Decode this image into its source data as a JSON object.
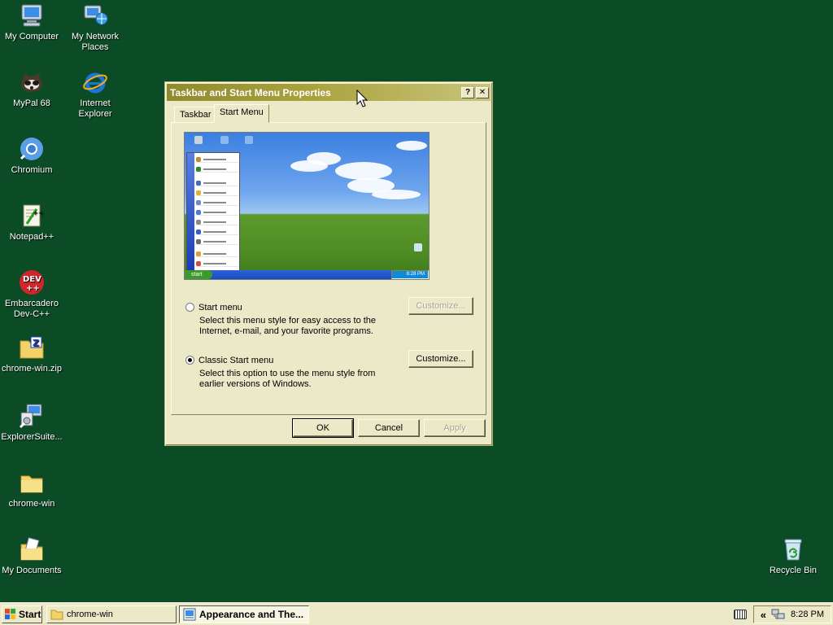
{
  "desktop_icons": [
    {
      "label": "My Computer",
      "icon": "computer-icon"
    },
    {
      "label": "My Network Places",
      "icon": "network-places-icon"
    },
    {
      "label": "MyPal 68",
      "icon": "mypal-icon"
    },
    {
      "label": "Internet Explorer",
      "icon": "internet-explorer-icon"
    },
    {
      "label": "Chromium",
      "icon": "chromium-icon"
    },
    {
      "label": "Notepad++",
      "icon": "notepad-plus-plus-icon"
    },
    {
      "label": "Embarcadero Dev-C++",
      "icon": "devcpp-icon"
    },
    {
      "label": "chrome-win.zip",
      "icon": "zip-folder-icon"
    },
    {
      "label": "ExplorerSuite...",
      "icon": "installer-icon"
    },
    {
      "label": "chrome-win",
      "icon": "folder-icon"
    },
    {
      "label": "My Documents",
      "icon": "my-documents-icon"
    },
    {
      "label": "Recycle Bin",
      "icon": "recycle-bin-icon"
    }
  ],
  "dialog": {
    "title": "Taskbar and Start Menu Properties",
    "help_button": "?",
    "close_button": "✕",
    "tabs": [
      {
        "label": "Taskbar",
        "selected": false
      },
      {
        "label": "Start Menu",
        "selected": true
      }
    ],
    "preview": {
      "start_label": "start",
      "clock": "8:28 PM"
    },
    "options": [
      {
        "label": "Start menu",
        "description": "Select this menu style for easy access to the Internet, e-mail, and your favorite programs.",
        "checked": false,
        "customize_label": "Customize...",
        "customize_enabled": false
      },
      {
        "label": "Classic Start menu",
        "description": "Select this option to use the menu style from earlier versions of Windows.",
        "checked": true,
        "customize_label": "Customize...",
        "customize_enabled": true
      }
    ],
    "buttons": {
      "ok": "OK",
      "cancel": "Cancel",
      "apply": "Apply"
    }
  },
  "taskbar": {
    "start_label": "Start",
    "tasks": [
      {
        "label": "chrome-win",
        "icon": "folder-icon",
        "active": false
      },
      {
        "label": "Appearance and The...",
        "icon": "control-panel-icon",
        "active": true
      }
    ],
    "tray": {
      "chevron": "«",
      "clock": "8:28 PM"
    }
  },
  "colors": {
    "desktop": "#0b4b26",
    "titlebar": "#a9a33f",
    "window": "#ece9c8"
  }
}
